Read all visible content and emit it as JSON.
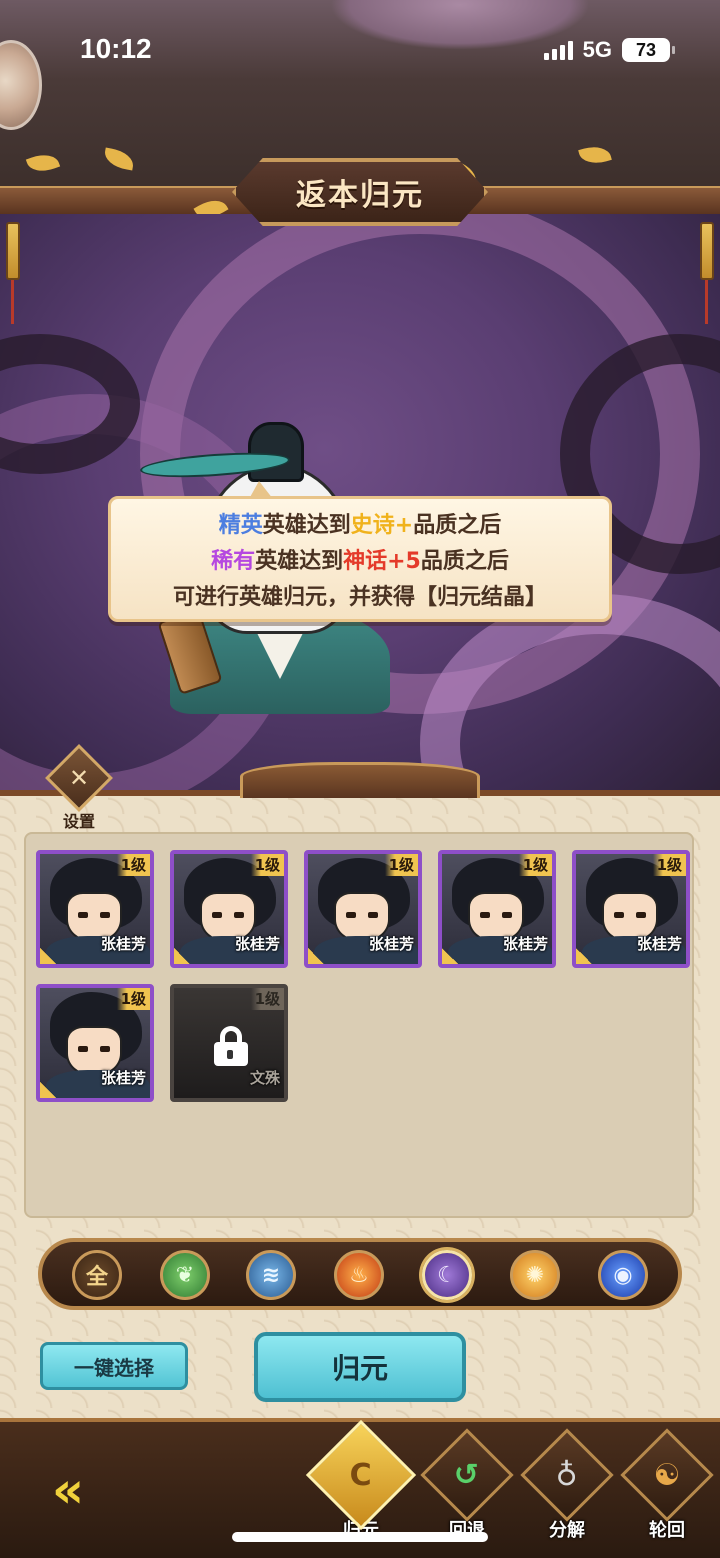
{
  "status_bar": {
    "time": "10:12",
    "network": "5G",
    "battery": "73"
  },
  "header": {
    "title": "返本归元"
  },
  "dialog": {
    "line1": {
      "rarity": "精英",
      "text1": "英雄达到",
      "quality": "史诗+",
      "text2": "品质之后"
    },
    "line2": {
      "rarity": "稀有",
      "text1": "英雄达到",
      "quality": "神话+5",
      "text2": "品质之后"
    },
    "line3": "可进行英雄归元，并获得【归元结晶】"
  },
  "settings": {
    "label": "设置",
    "icon": "wrench-hammer-icon"
  },
  "heroes": [
    {
      "name": "张桂芳",
      "level": "1级",
      "locked": false
    },
    {
      "name": "张桂芳",
      "level": "1级",
      "locked": false
    },
    {
      "name": "张桂芳",
      "level": "1级",
      "locked": false
    },
    {
      "name": "张桂芳",
      "level": "1级",
      "locked": false
    },
    {
      "name": "张桂芳",
      "level": "1级",
      "locked": false
    },
    {
      "name": "张桂芳",
      "level": "1级",
      "locked": false
    },
    {
      "name": "文殊",
      "level": "1级",
      "locked": true
    }
  ],
  "filters": [
    {
      "key": "all",
      "label": "全",
      "icon": "all-icon"
    },
    {
      "key": "wood",
      "label": "",
      "icon": "leaf-icon"
    },
    {
      "key": "water",
      "label": "",
      "icon": "water-wave-icon"
    },
    {
      "key": "fire",
      "label": "",
      "icon": "flame-icon"
    },
    {
      "key": "dark",
      "label": "",
      "icon": "crescent-moon-icon",
      "selected": true
    },
    {
      "key": "light",
      "label": "",
      "icon": "sun-icon"
    },
    {
      "key": "storm",
      "label": "",
      "icon": "vortex-icon"
    }
  ],
  "actions": {
    "select_all": "一键选择",
    "confirm": "归元"
  },
  "bottom_nav": {
    "back_icon": "back-arrow-icon",
    "items": [
      {
        "label": "归元",
        "icon": "rebirth-orb-icon",
        "active": true
      },
      {
        "label": "回退",
        "icon": "rewind-icon",
        "active": false
      },
      {
        "label": "分解",
        "icon": "cauldron-icon",
        "active": false
      },
      {
        "label": "轮回",
        "icon": "reincarnation-swirl-icon",
        "active": false
      }
    ]
  },
  "colors": {
    "elite_blue": "#4c7ee0",
    "epic_gold": "#f0b21c",
    "rare_purple": "#b548e0",
    "myth_red": "#e43a2a",
    "button_cyan": "#52c4d4"
  }
}
